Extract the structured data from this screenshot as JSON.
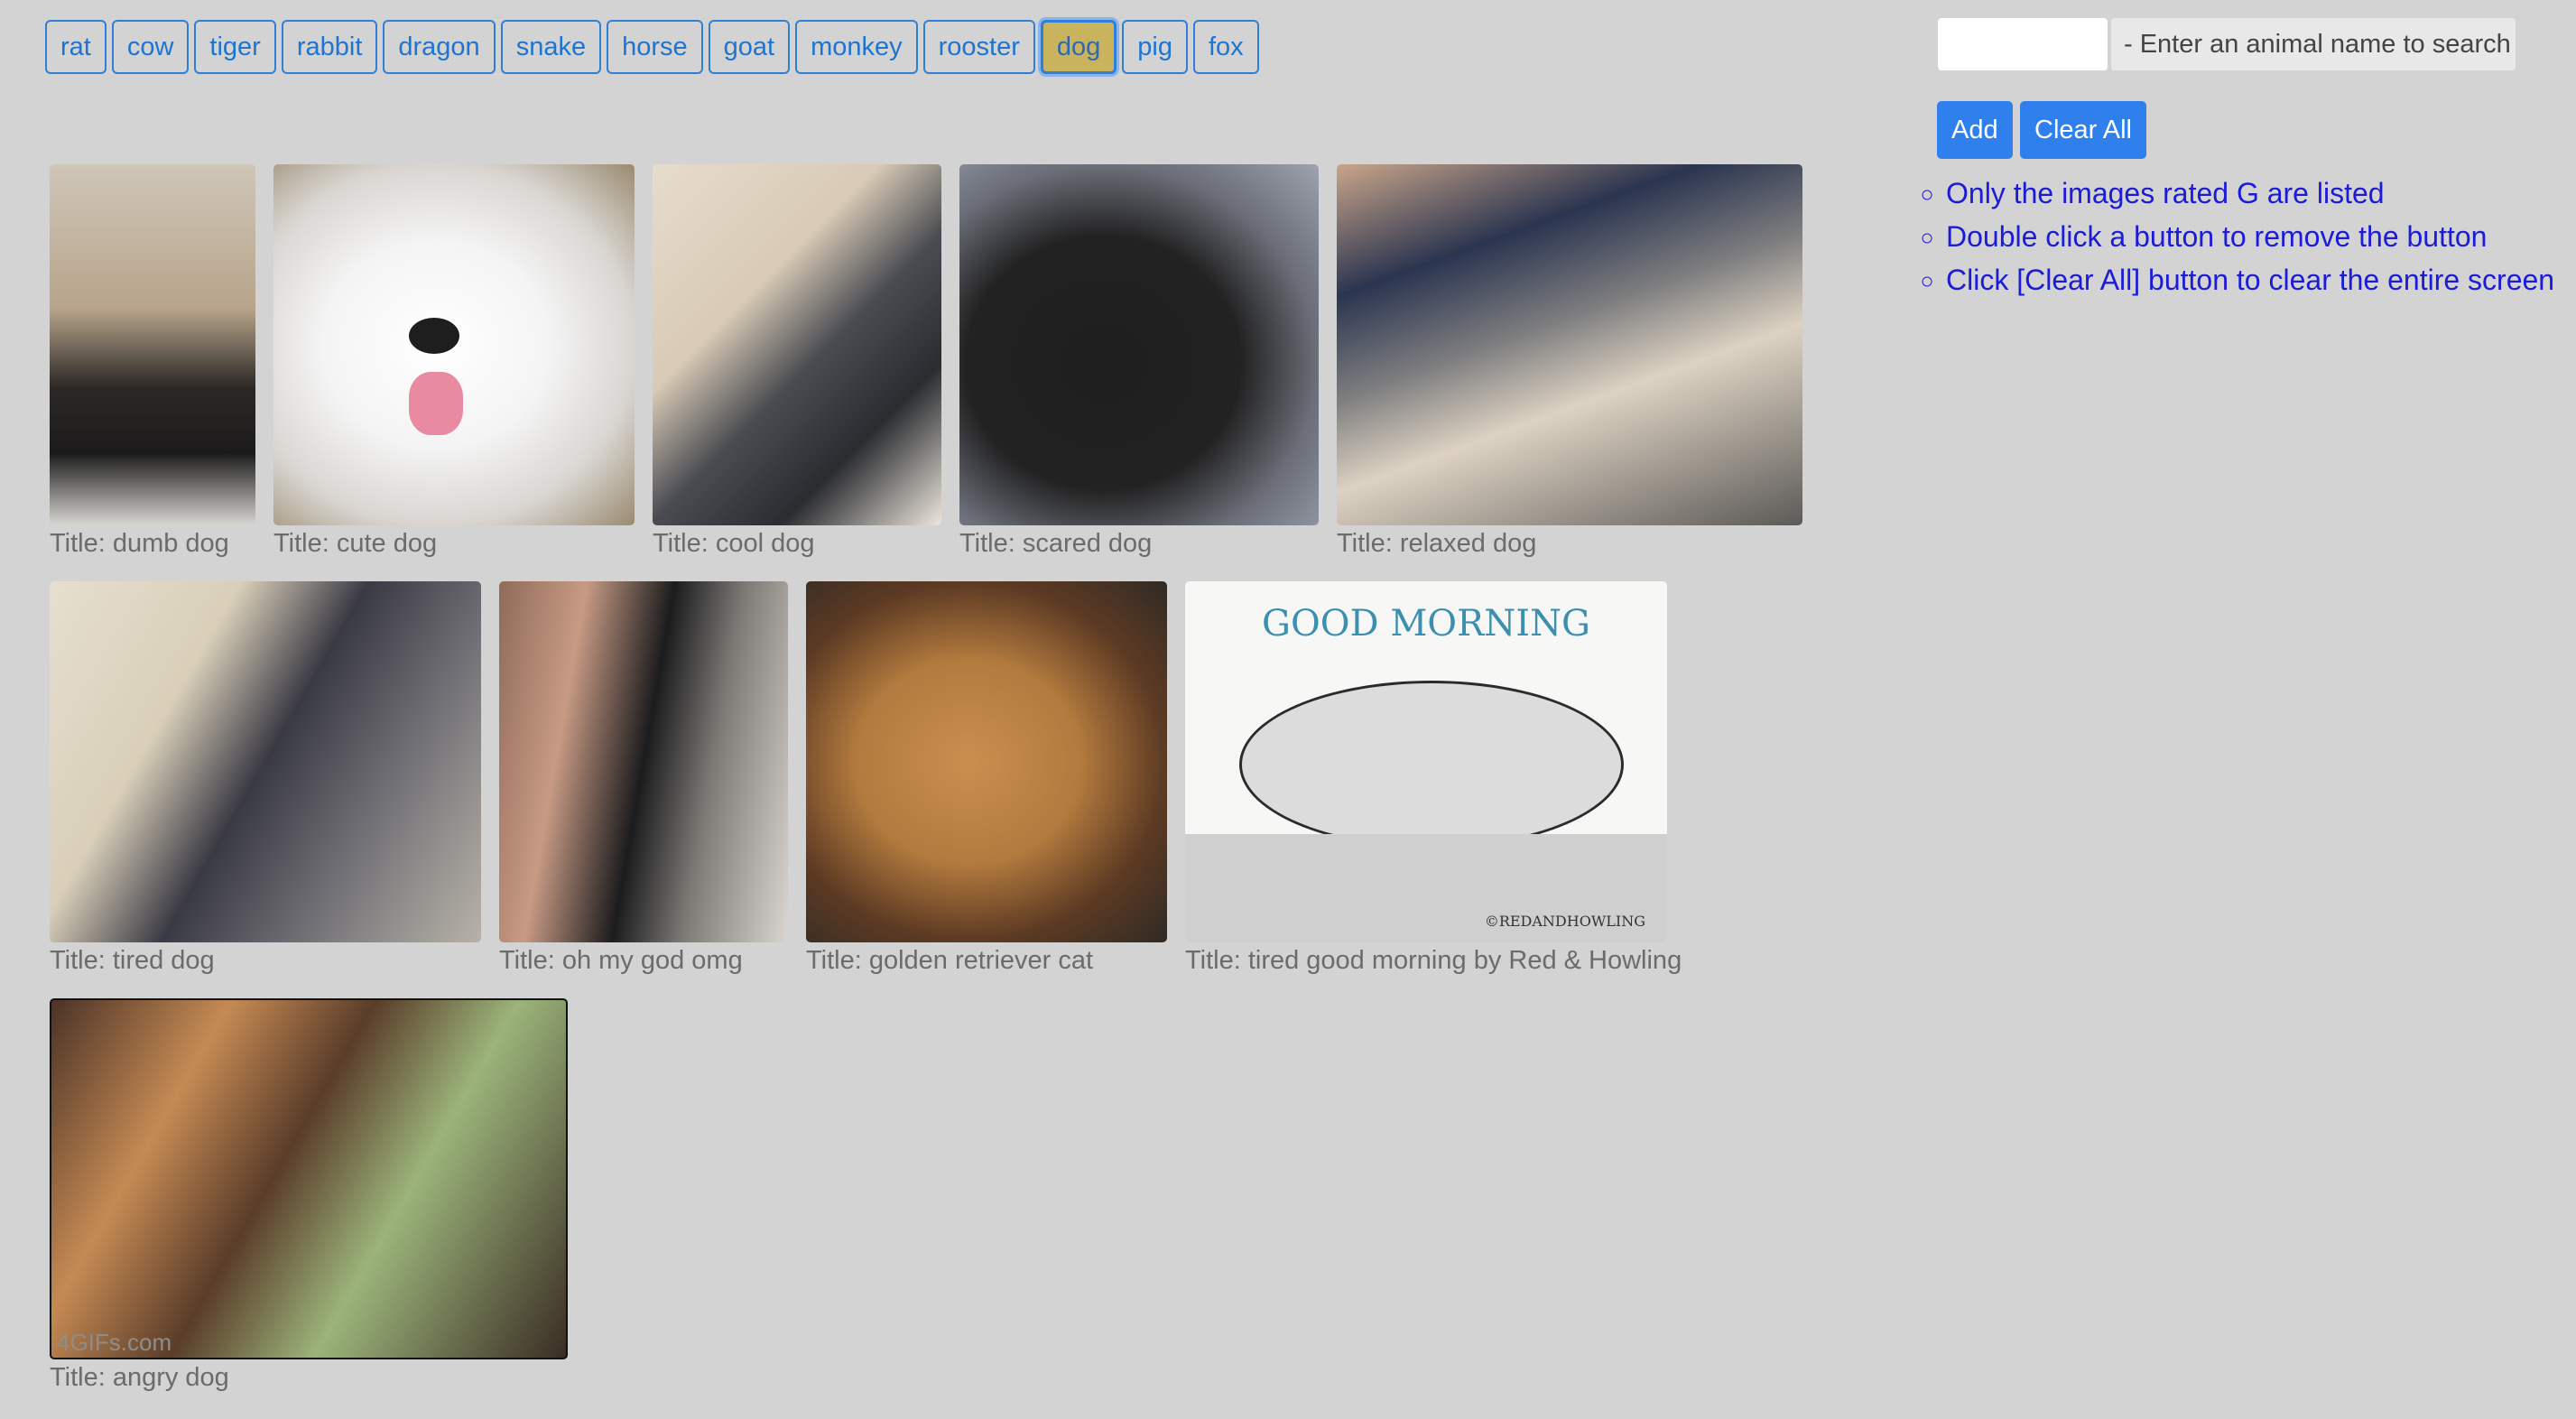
{
  "animals": [
    "rat",
    "cow",
    "tiger",
    "rabbit",
    "dragon",
    "snake",
    "horse",
    "goat",
    "monkey",
    "rooster",
    "dog",
    "pig",
    "fox"
  ],
  "selected_animal": "dog",
  "search": {
    "placeholder": "",
    "hint": "- Enter an animal name to search"
  },
  "buttons": {
    "add": "Add",
    "clear_all": "Clear All"
  },
  "instructions": [
    "Only the images rated G are listed",
    "Double click a button to remove the button",
    "Click [Clear All] button to clear the entire screen"
  ],
  "gifs": [
    {
      "title": "Title: dumb dog"
    },
    {
      "title": "Title: cute dog"
    },
    {
      "title": "Title: cool dog"
    },
    {
      "title": "Title: scared dog"
    },
    {
      "title": "Title: relaxed dog"
    },
    {
      "title": "Title: tired dog"
    },
    {
      "title": "Title: oh my god omg"
    },
    {
      "title": "Title: golden retriever cat"
    },
    {
      "title": "Title: tired good morning by Red & Howling",
      "caption": "GOOD MORNING",
      "watermark": "©REDANDHOWLING"
    },
    {
      "title": "Title: angry dog",
      "watermark": "4GIFs.com"
    }
  ]
}
